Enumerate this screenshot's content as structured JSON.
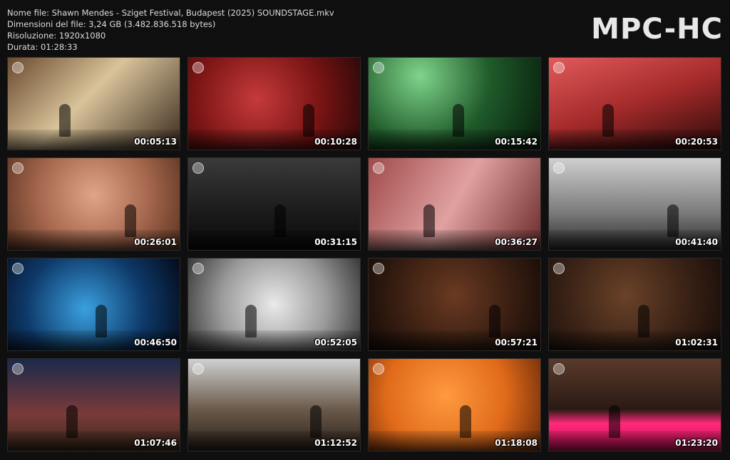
{
  "info": {
    "file_name": "Nome file: Shawn Mendes - Sziget Festival, Budapest (2025) SOUNDSTAGE.mkv",
    "file_size": "Dimensioni del file: 3,24 GB (3.482.836.518 bytes)",
    "resolution": "Risoluzione: 1920x1080",
    "duration": "Durata: 01:28:33"
  },
  "logo": "MPC-HC",
  "thumbnails": [
    {
      "time": "00:05:13",
      "bg": "linear-gradient(135deg,#6a4a2e,#d8c39a 45%,#3a2a1e)"
    },
    {
      "time": "00:10:28",
      "bg": "radial-gradient(circle at 40% 45%,#c63a3a,#7a1414 55%,#2a0808)"
    },
    {
      "time": "00:15:42",
      "bg": "radial-gradient(circle at 30% 20%,#7fd48a,#1f5a2a 50%,#061a0a)"
    },
    {
      "time": "00:20:53",
      "bg": "linear-gradient(160deg,#e25a5a,#a42a2a 50%,#2a0a0a)"
    },
    {
      "time": "00:26:01",
      "bg": "radial-gradient(circle at 50% 40%,#e0a589,#a4664c 55%,#5a3322)"
    },
    {
      "time": "00:31:15",
      "bg": "linear-gradient(180deg,#3a3a3a,#1a1a1a 60%,#0a0a0a)"
    },
    {
      "time": "00:36:27",
      "bg": "linear-gradient(120deg,#a04a4a,#e0a1a1 50%,#6a2a2a)"
    },
    {
      "time": "00:41:40",
      "bg": "linear-gradient(180deg,#cfcfcf,#7a7a7a 60%,#2a2a2a)"
    },
    {
      "time": "00:46:50",
      "bg": "radial-gradient(circle at 45% 55%,#3aa0e0,#0e3a6a 55%,#040a1a)"
    },
    {
      "time": "00:52:05",
      "bg": "radial-gradient(circle at 50% 50%,#eaeaea,#9a9a9a 55%,#3a3a3a)"
    },
    {
      "time": "00:57:21",
      "bg": "radial-gradient(circle at 50% 40%,#6a3a22,#3a1f12 55%,#140a06)"
    },
    {
      "time": "01:02:31",
      "bg": "radial-gradient(circle at 45% 40%,#6a4228,#3a2216 55%,#160c08)"
    },
    {
      "time": "01:07:46",
      "bg": "linear-gradient(180deg,#1a2a4a,#7a3a3a 60%,#3a2a1a)"
    },
    {
      "time": "01:12:52",
      "bg": "linear-gradient(180deg,#d0d0d0,#6a5a4a 55%,#2a2018)"
    },
    {
      "time": "01:18:08",
      "bg": "radial-gradient(circle at 45% 40%,#ff9a40,#e06a1a 55%,#6a2a0a)"
    },
    {
      "time": "01:23:20",
      "bg": "linear-gradient(180deg,#5a3a2a 0%,#2a1a14 55%,#ff2a7a 70%,#d0105a 100%)"
    }
  ]
}
